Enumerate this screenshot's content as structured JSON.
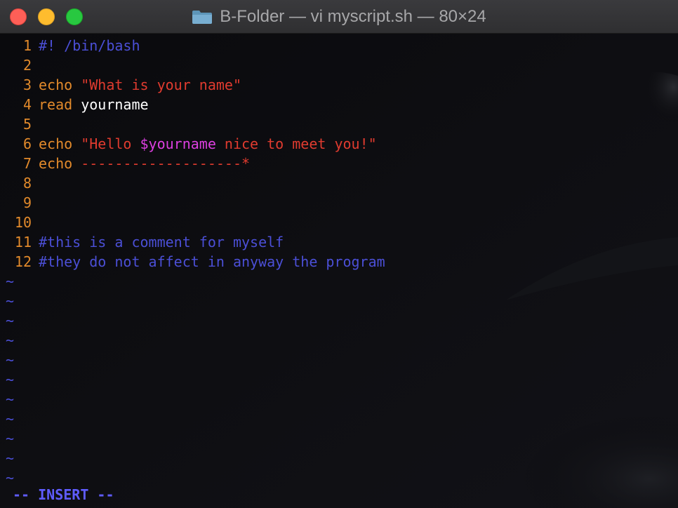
{
  "window": {
    "title": "B-Folder — vi myscript.sh — 80×24",
    "folder_icon": "folder-icon",
    "buttons": {
      "close": "close",
      "minimize": "minimize",
      "zoom": "zoom"
    }
  },
  "colors": {
    "line_number": "#e28a2b",
    "keyword": "#e28a2b",
    "string": "#e03b2f",
    "variable": "#dc3fe0",
    "comment": "#4b4fd6",
    "plain": "#ffffff",
    "tilde": "#4b4fd6",
    "mode": "#5f5cff"
  },
  "editor": {
    "lines": [
      {
        "num": "1",
        "tokens": [
          {
            "t": "#! /bin/bash",
            "k": "comment"
          }
        ]
      },
      {
        "num": "2",
        "tokens": []
      },
      {
        "num": "3",
        "tokens": [
          {
            "t": "echo ",
            "k": "keyword"
          },
          {
            "t": "\"What is your name\"",
            "k": "string"
          }
        ]
      },
      {
        "num": "4",
        "tokens": [
          {
            "t": "read ",
            "k": "keyword"
          },
          {
            "t": "yourname",
            "k": "plain"
          }
        ]
      },
      {
        "num": "5",
        "tokens": []
      },
      {
        "num": "6",
        "tokens": [
          {
            "t": "echo ",
            "k": "keyword"
          },
          {
            "t": "\"Hello ",
            "k": "string"
          },
          {
            "t": "$yourname",
            "k": "variable"
          },
          {
            "t": " nice to meet you!\"",
            "k": "string"
          }
        ]
      },
      {
        "num": "7",
        "tokens": [
          {
            "t": "echo ",
            "k": "keyword"
          },
          {
            "t": "-------------------*",
            "k": "string"
          }
        ]
      },
      {
        "num": "8",
        "tokens": []
      },
      {
        "num": "9",
        "tokens": []
      },
      {
        "num": "10",
        "tokens": []
      },
      {
        "num": "11",
        "tokens": [
          {
            "t": "#this is a comment for myself",
            "k": "comment"
          }
        ]
      },
      {
        "num": "12",
        "tokens": [
          {
            "t": "#they do not affect in anyway the program",
            "k": "comment"
          }
        ]
      }
    ],
    "tilde_char": "~",
    "tilde_count": 11,
    "mode_text": "-- INSERT --"
  }
}
